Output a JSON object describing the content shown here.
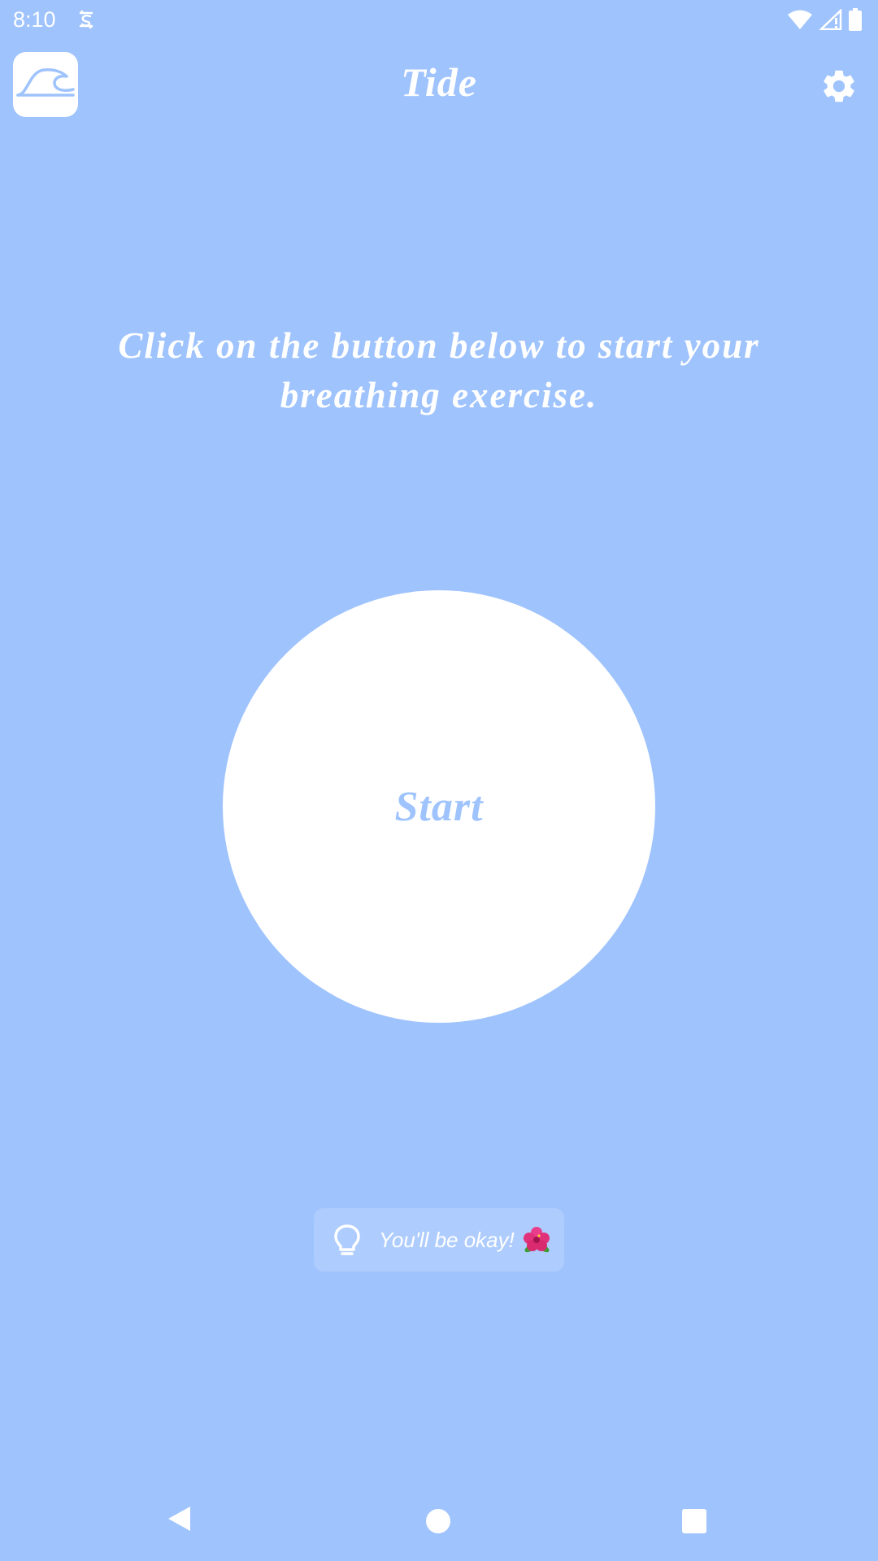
{
  "status_bar": {
    "time": "8:10",
    "icons": [
      "sync-icon",
      "wifi-icon",
      "cellular-signal-icon",
      "battery-icon"
    ]
  },
  "app_bar": {
    "title": "Tide",
    "logo_icon": "wave-icon",
    "settings_icon": "gear-icon"
  },
  "main": {
    "instruction": "Click on the button below to start your breathing exercise.",
    "start_label": "Start"
  },
  "tip": {
    "icon": "lightbulb-icon",
    "text": "You'll be okay!",
    "emoji_icon": "hibiscus-icon"
  },
  "nav_bar": {
    "buttons": [
      "back-icon",
      "home-icon",
      "recents-icon"
    ]
  },
  "colors": {
    "background": "#9fc3fd",
    "foreground": "#ffffff"
  }
}
